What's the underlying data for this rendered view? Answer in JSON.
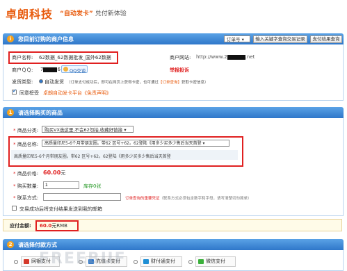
{
  "header": {
    "logo": "卓朗科技",
    "slogan_highlight": "“自动发卡”",
    "slogan_rest": "兑付新体验"
  },
  "toolbar": {
    "order_select": "订单号",
    "query_input_label": "输入关键字查询交易记录",
    "status_button": "支付结果查询"
  },
  "merchant": {
    "section_title": "您目前订购的商户信息",
    "name_label": "商户名称:",
    "name_value": "62数据_62数据批发_国外62数据",
    "website_label": "商户网站:",
    "website_value": "http://www.2",
    "website_suffix": ".net",
    "qq_label": "商户ＱＱ:",
    "qq_prefix": "7",
    "qq_suffix": "6",
    "qq_button": "QQ交谈",
    "report_link": "举报投诉",
    "delivery_label": "发货类型:",
    "delivery_value": "自动发货",
    "delivery_note": "（订单支付成功后，即可在网页上获得卡密，也可通过",
    "delivery_link": "【订单查询】",
    "delivery_note2": "获取卡密信息）",
    "guarantee_label": "同意榜受",
    "guarantee_link": "卓朗自动发卡平台《免责声明》"
  },
  "product": {
    "section_title": "请选择购买的商品",
    "category_label": "商品分类:",
    "category_value": "购买VX选这里,不会62勿拍,收藏好链接",
    "name_label": "商品名称:",
    "name_value": "高质量印尼5-6个月带朋友圈。带62 区号+62。62登陆《用多少买多少售后当天首登",
    "name_desc": "高质量印尼5-6个月带朋友圈。带62 区号+62。62登陆《用多少买多少售后当天首登",
    "price_label": "商品价格:",
    "price_value": "60.00",
    "price_unit": "元",
    "qty_label": "购买数量:",
    "qty_value": "1",
    "stock_text": "库存0张",
    "contact_label": "联系方式:",
    "contact_note_red": "订单查询的重要凭证",
    "contact_note": "（联系方式必须包含数字和字母，请写清楚切勿简单）",
    "email_label": "交易成功后将支付结果发送到我的邮箱"
  },
  "total": {
    "label": "应付金额:",
    "amount": "60.0",
    "unit": "元RMB"
  },
  "payment": {
    "section_title": "请选择付款方式",
    "methods": [
      {
        "label": "网银支付",
        "color": "#d4382a"
      },
      {
        "label": "充值卡支付",
        "color": "#2f77c9"
      },
      {
        "label": "财付通支付",
        "color": "#1f8fd4"
      },
      {
        "label": "微信支付",
        "color": "#3bb03b"
      }
    ]
  },
  "watermark": "FREEBUF"
}
